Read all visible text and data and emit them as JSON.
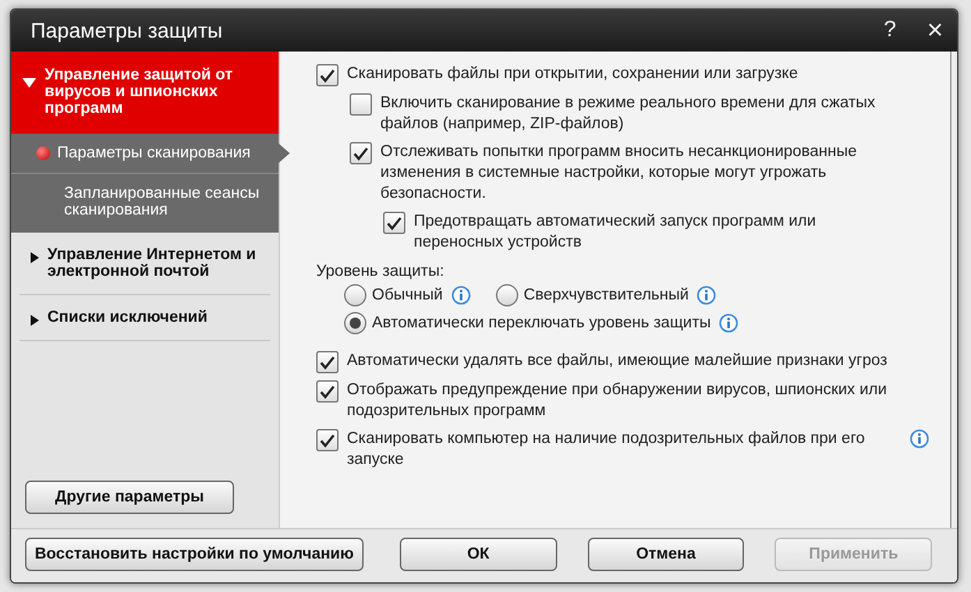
{
  "window": {
    "title": "Параметры защиты",
    "help": "?",
    "close": "×"
  },
  "sidebar": {
    "sections": [
      {
        "label": "Управление защитой от вирусов и шпионских программ",
        "expanded": true,
        "selected": true,
        "children": [
          {
            "label": "Параметры сканирования",
            "selected": true
          },
          {
            "label": "Запланированные сеансы сканирования",
            "selected": false
          }
        ]
      },
      {
        "label": "Управление Интернетом и электронной почтой",
        "expanded": false,
        "selected": false
      },
      {
        "label": "Списки исключений",
        "expanded": false,
        "selected": false
      }
    ],
    "button": "Другие параметры"
  },
  "scan_options": [
    {
      "label": "Сканировать файлы при открытии, сохранении или загрузке",
      "checked": true,
      "children": [
        {
          "label": "Включить сканирование в режиме реального времени для сжатых файлов (например, ZIP-файлов)",
          "checked": false
        },
        {
          "label": "Отслеживать попытки программ вносить несанкционированные изменения в системные настройки, которые могут угрожать безопасности.",
          "checked": true,
          "children": [
            {
              "label": "Предотвращать автоматический запуск программ или переносных устройств",
              "checked": true
            }
          ]
        }
      ]
    }
  ],
  "protection_level": {
    "label": "Уровень защиты:",
    "options": [
      {
        "label": "Обычный",
        "selected": false,
        "info": true
      },
      {
        "label": "Сверхчувствительный",
        "selected": false,
        "info": true
      },
      {
        "label": "Автоматически переключать уровень защиты",
        "selected": true,
        "info": true
      }
    ]
  },
  "actions": [
    {
      "label": "Автоматически удалять все файлы, имеющие малейшие признаки угроз",
      "checked": true
    },
    {
      "label": "Отображать предупреждение при обнаружении вирусов, шпионских или подозрительных программ",
      "checked": true
    },
    {
      "label": "Сканировать компьютер на наличие подозрительных файлов при его запуске",
      "checked": true,
      "info": true
    }
  ],
  "footer": {
    "buttons": [
      {
        "label": "Восстановить настройки по умолчанию",
        "disabled": false
      },
      {
        "label": "ОК",
        "disabled": false
      },
      {
        "label": "Отмена",
        "disabled": false
      },
      {
        "label": "Применить",
        "disabled": true
      }
    ]
  }
}
